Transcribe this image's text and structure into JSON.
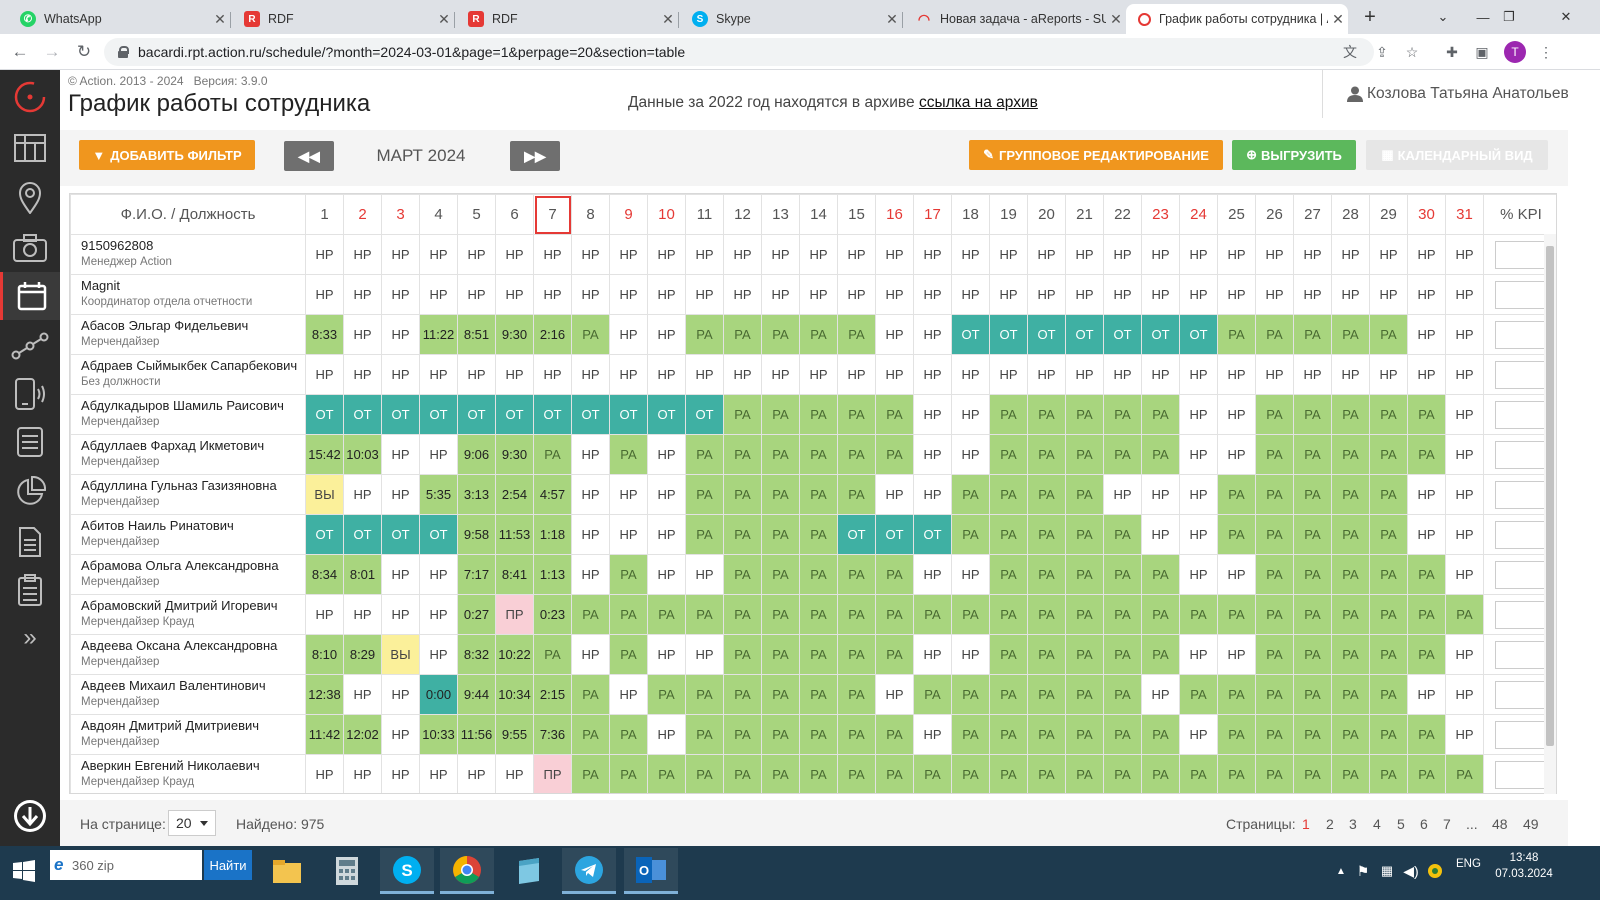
{
  "browser": {
    "tabs": [
      {
        "title": "WhatsApp",
        "icon": "whatsapp-icon",
        "color": "#25d366"
      },
      {
        "title": "RDF",
        "icon": "rdf-icon",
        "color": "#e53935"
      },
      {
        "title": "RDF",
        "icon": "rdf-icon",
        "color": "#e53935"
      },
      {
        "title": "Skype",
        "icon": "skype-icon",
        "color": "#00aff0"
      },
      {
        "title": "Новая задача - aReports - SUP",
        "icon": "areports-icon",
        "color": "#e53935"
      },
      {
        "title": "График работы сотрудника | Action",
        "icon": "action-icon",
        "color": "#e53935"
      }
    ],
    "url": "bacardi.rpt.action.ru/schedule/?month=2024-03-01&page=1&perpage=20&section=table",
    "profile_initial": "T"
  },
  "header": {
    "copyright": "© Action. 2013 - 2024",
    "version": "Версия: 3.9.0",
    "title": "График работы сотрудника",
    "archive_text": "Данные за 2022 год находятся в архиве",
    "archive_link": "ссылка на архив",
    "user": "Козлова Татьяна Анатольевна"
  },
  "toolbar": {
    "add_filter": "ДОБАВИТЬ ФИЛЬТР",
    "prev": "◀◀",
    "month": "МАРТ 2024",
    "next": "▶▶",
    "group_edit": "ГРУППОВОЕ РЕДАКТИРОВАНИЕ",
    "export": "ВЫГРУЗИТЬ",
    "calendar_view": "КАЛЕНДАРНЫЙ ВИД"
  },
  "table": {
    "name_header": "Ф.И.О. / Должность",
    "kpi_header": "% KPI",
    "days": [
      "1",
      "2",
      "3",
      "4",
      "5",
      "6",
      "7",
      "8",
      "9",
      "10",
      "11",
      "12",
      "13",
      "14",
      "15",
      "16",
      "17",
      "18",
      "19",
      "20",
      "21",
      "22",
      "23",
      "24",
      "25",
      "26",
      "27",
      "28",
      "29",
      "30",
      "31"
    ],
    "weekend_days": [
      2,
      3,
      9,
      10,
      16,
      17,
      23,
      24,
      30,
      31
    ],
    "today": 7,
    "rows": [
      {
        "name": "9150962808",
        "position": "Менеджер Action",
        "cells": [
          "НР",
          "НР",
          "НР",
          "НР",
          "НР",
          "НР",
          "НР",
          "НР",
          "НР",
          "НР",
          "НР",
          "НР",
          "НР",
          "НР",
          "НР",
          "НР",
          "НР",
          "НР",
          "НР",
          "НР",
          "НР",
          "НР",
          "НР",
          "НР",
          "НР",
          "НР",
          "НР",
          "НР",
          "НР",
          "НР",
          "НР"
        ]
      },
      {
        "name": "Magnit",
        "position": "Координатор отдела отчетности",
        "cells": [
          "НР",
          "НР",
          "НР",
          "НР",
          "НР",
          "НР",
          "НР",
          "НР",
          "НР",
          "НР",
          "НР",
          "НР",
          "НР",
          "НР",
          "НР",
          "НР",
          "НР",
          "НР",
          "НР",
          "НР",
          "НР",
          "НР",
          "НР",
          "НР",
          "НР",
          "НР",
          "НР",
          "НР",
          "НР",
          "НР",
          "НР"
        ]
      },
      {
        "name": "Абасов Эльгар Фидельевич",
        "position": "Мерчендайзер",
        "cells": [
          "8:33",
          "НР",
          "НР",
          "11:22",
          "8:51",
          "9:30",
          "2:16",
          "РА",
          "НР",
          "НР",
          "РА",
          "РА",
          "РА",
          "РА",
          "РА",
          "НР",
          "НР",
          "ОТ",
          "ОТ",
          "ОТ",
          "ОТ",
          "ОТ",
          "ОТ",
          "ОТ",
          "РА",
          "РА",
          "РА",
          "РА",
          "РА",
          "НР",
          "НР"
        ]
      },
      {
        "name": "Абдраев Сыймыкбек Сапарбекович",
        "position": "Без должности",
        "cells": [
          "НР",
          "НР",
          "НР",
          "НР",
          "НР",
          "НР",
          "НР",
          "НР",
          "НР",
          "НР",
          "НР",
          "НР",
          "НР",
          "НР",
          "НР",
          "НР",
          "НР",
          "НР",
          "НР",
          "НР",
          "НР",
          "НР",
          "НР",
          "НР",
          "НР",
          "НР",
          "НР",
          "НР",
          "НР",
          "НР",
          "НР"
        ]
      },
      {
        "name": "Абдулкадыров Шамиль Раисович",
        "position": "Мерчендайзер",
        "cells": [
          "ОТ",
          "ОТ",
          "ОТ",
          "ОТ",
          "ОТ",
          "ОТ",
          "ОТ",
          "ОТ",
          "ОТ",
          "ОТ",
          "ОТ",
          "РА",
          "РА",
          "РА",
          "РА",
          "РА",
          "НР",
          "НР",
          "РА",
          "РА",
          "РА",
          "РА",
          "РА",
          "НР",
          "НР",
          "РА",
          "РА",
          "РА",
          "РА",
          "РА",
          "НР"
        ]
      },
      {
        "name": "Абдуллаев Фархад Икметович",
        "position": "Мерчендайзер",
        "cells": [
          "15:42",
          "10:03",
          "НР",
          "НР",
          "9:06",
          "9:30",
          "РА",
          "НР",
          "РА",
          "НР",
          "РА",
          "РА",
          "РА",
          "РА",
          "РА",
          "РА",
          "НР",
          "НР",
          "РА",
          "РА",
          "РА",
          "РА",
          "РА",
          "НР",
          "НР",
          "РА",
          "РА",
          "РА",
          "РА",
          "РА",
          "НР"
        ]
      },
      {
        "name": "Абдуллина Гульназ Газизяновна",
        "position": "Мерчендайзер",
        "cells": [
          "ВЫ",
          "НР",
          "НР",
          "5:35",
          "3:13",
          "2:54",
          "4:57",
          "НР",
          "НР",
          "НР",
          "РА",
          "РА",
          "РА",
          "РА",
          "РА",
          "НР",
          "НР",
          "РА",
          "РА",
          "РА",
          "РА",
          "НР",
          "НР",
          "НР",
          "РА",
          "РА",
          "РА",
          "РА",
          "РА",
          "НР",
          "НР"
        ]
      },
      {
        "name": "Абитов Наиль Ринатович",
        "position": "Мерчендайзер",
        "cells": [
          "ОТ",
          "ОТ",
          "ОТ",
          "ОТ",
          "9:58",
          "11:53",
          "1:18",
          "НР",
          "НР",
          "НР",
          "РА",
          "РА",
          "РА",
          "РА",
          "ОТ",
          "ОТ",
          "ОТ",
          "РА",
          "РА",
          "РА",
          "РА",
          "РА",
          "НР",
          "НР",
          "РА",
          "РА",
          "РА",
          "РА",
          "РА",
          "НР",
          "НР"
        ]
      },
      {
        "name": "Абрамова Ольга Александровна",
        "position": "Мерчендайзер",
        "cells": [
          "8:34",
          "8:01",
          "НР",
          "НР",
          "7:17",
          "8:41",
          "1:13",
          "НР",
          "РА",
          "НР",
          "НР",
          "РА",
          "РА",
          "РА",
          "РА",
          "РА",
          "НР",
          "НР",
          "РА",
          "РА",
          "РА",
          "РА",
          "РА",
          "НР",
          "НР",
          "РА",
          "РА",
          "РА",
          "РА",
          "РА",
          "НР"
        ]
      },
      {
        "name": "Абрамовский Дмитрий Игоревич",
        "position": "Мерчендайзер Крауд",
        "cells": [
          "НР",
          "НР",
          "НР",
          "НР",
          "0:27",
          "ПР",
          "0:23",
          "РА",
          "РА",
          "РА",
          "РА",
          "РА",
          "РА",
          "РА",
          "РА",
          "РА",
          "РА",
          "РА",
          "РА",
          "РА",
          "РА",
          "РА",
          "РА",
          "РА",
          "РА",
          "РА",
          "РА",
          "РА",
          "РА",
          "РА",
          "РА"
        ]
      },
      {
        "name": "Авдеева Оксана Александровна",
        "position": "Мерчендайзер",
        "cells": [
          "8:10",
          "8:29",
          "ВЫ",
          "НР",
          "8:32",
          "10:22",
          "РА",
          "НР",
          "РА",
          "НР",
          "НР",
          "РА",
          "РА",
          "РА",
          "РА",
          "РА",
          "НР",
          "НР",
          "РА",
          "РА",
          "РА",
          "РА",
          "РА",
          "НР",
          "НР",
          "РА",
          "РА",
          "РА",
          "РА",
          "РА",
          "НР"
        ]
      },
      {
        "name": "Авдеев Михаил Валентинович",
        "position": "Мерчендайзер",
        "cells": [
          "12:38",
          "НР",
          "НР",
          "0:00",
          "9:44",
          "10:34",
          "2:15",
          "РА",
          "НР",
          "РА",
          "РА",
          "РА",
          "РА",
          "РА",
          "РА",
          "НР",
          "РА",
          "РА",
          "РА",
          "РА",
          "РА",
          "РА",
          "НР",
          "РА",
          "РА",
          "РА",
          "РА",
          "РА",
          "РА",
          "НР",
          "НР"
        ]
      },
      {
        "name": "Авдоян Дмитрий Дмитриевич",
        "position": "Мерчендайзер",
        "cells": [
          "11:42",
          "12:02",
          "НР",
          "10:33",
          "11:56",
          "9:55",
          "7:36",
          "РА",
          "РА",
          "НР",
          "РА",
          "РА",
          "РА",
          "РА",
          "РА",
          "РА",
          "НР",
          "РА",
          "РА",
          "РА",
          "РА",
          "РА",
          "РА",
          "НР",
          "РА",
          "РА",
          "РА",
          "РА",
          "РА",
          "РА",
          "НР"
        ]
      },
      {
        "name": "Аверкин Евгений Николаевич",
        "position": "Мерчендайзер Крауд",
        "cells": [
          "НР",
          "НР",
          "НР",
          "НР",
          "НР",
          "НР",
          "ПР",
          "РА",
          "РА",
          "РА",
          "РА",
          "РА",
          "РА",
          "РА",
          "РА",
          "РА",
          "РА",
          "РА",
          "РА",
          "РА",
          "РА",
          "РА",
          "РА",
          "РА",
          "РА",
          "РА",
          "РА",
          "РА",
          "РА",
          "РА",
          "РА"
        ]
      }
    ]
  },
  "footer": {
    "per_page_label": "На странице:",
    "per_page_value": "20",
    "found": "Найдено: 975",
    "pages_label": "Страницы:",
    "pages": [
      "1",
      "2",
      "3",
      "4",
      "5",
      "6",
      "7",
      "...",
      "48",
      "49"
    ],
    "current_page": "1"
  },
  "taskbar": {
    "search_value": "360 zip",
    "search_button": "Найти",
    "lang": "ENG",
    "time": "13:48",
    "date": "07.03.2024"
  },
  "colors": {
    "work_green": "#a8d57e",
    "vacation_teal": "#3fb0a3",
    "day_off_yellow": "#fbf09a",
    "absence_pink": "#f9cfd6",
    "accent_orange": "#f0961e",
    "accent_red": "#e53935",
    "sidebar_dark": "#2b2b2b"
  }
}
